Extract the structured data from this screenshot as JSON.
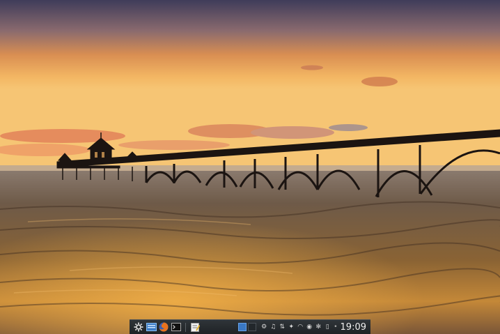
{
  "desktop": {
    "wallpaper": "sunset-pier-photo",
    "colors": {
      "sky_top": "#4a4560",
      "sky_mid": "#e89a4a",
      "horizon": "#f5c070",
      "sea": "#6b4a2a"
    }
  },
  "panel": {
    "launcher_icon": "kde-menu-icon",
    "tasks": [
      {
        "icon": "file-manager-icon"
      },
      {
        "icon": "firefox-icon"
      },
      {
        "icon": "terminal-icon"
      },
      {
        "icon": "text-editor-icon"
      }
    ],
    "pager": {
      "desktops": 2,
      "active": 1
    },
    "tray_icons": [
      "settings-icon",
      "audio-icon",
      "network-icon",
      "bird-icon",
      "wifi-icon",
      "power-icon",
      "bluetooth-icon",
      "battery-icon"
    ],
    "clock": "19:09"
  }
}
